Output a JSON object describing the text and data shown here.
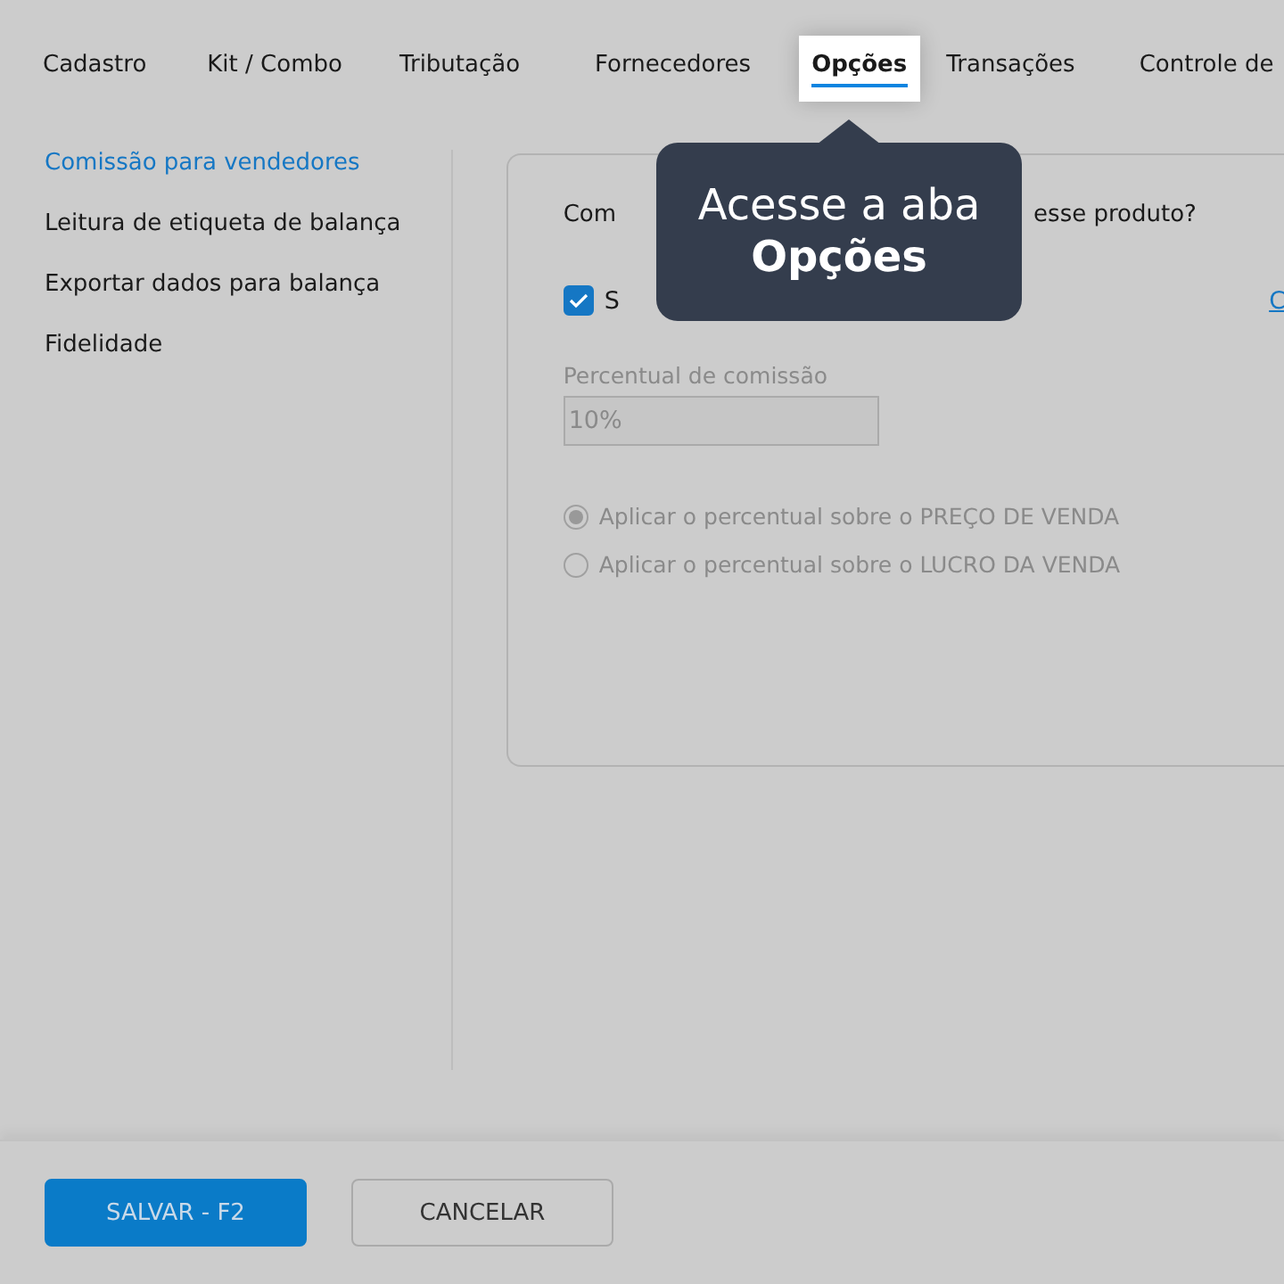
{
  "tabs": [
    {
      "label": "Cadastro",
      "selected": false
    },
    {
      "label": "Kit / Combo",
      "selected": false
    },
    {
      "label": "Tributação",
      "selected": false
    },
    {
      "label": "Fornecedores",
      "selected": false
    },
    {
      "label": "Opções",
      "selected": true
    },
    {
      "label": "Transações",
      "selected": false
    },
    {
      "label": "Controle de",
      "selected": false
    }
  ],
  "sidebar": {
    "items": [
      {
        "label": "Comissão para vendedores",
        "selected": true
      },
      {
        "label": "Leitura de etiqueta de balança",
        "selected": false
      },
      {
        "label": "Exportar dados para balança",
        "selected": false
      },
      {
        "label": "Fidelidade",
        "selected": false
      }
    ]
  },
  "panel": {
    "question_start": "Com",
    "question_end": "esse produto?",
    "checkbox": {
      "label": "S",
      "checked": true
    },
    "link": "C",
    "field": {
      "label": "Percentual de comissão",
      "value": "10%",
      "disabled": true
    },
    "radios": [
      {
        "label": "Aplicar o percentual sobre o PREÇO DE VENDA",
        "selected": true
      },
      {
        "label": "Aplicar o percentual sobre o LUCRO DA VENDA",
        "selected": false
      }
    ]
  },
  "tooltip": {
    "text": "Acesse a aba **Opções**"
  },
  "footer": {
    "buttons": [
      {
        "label": "SALVAR - F2",
        "kind": "primary"
      },
      {
        "label": "CANCELAR",
        "kind": "secondary"
      }
    ]
  }
}
